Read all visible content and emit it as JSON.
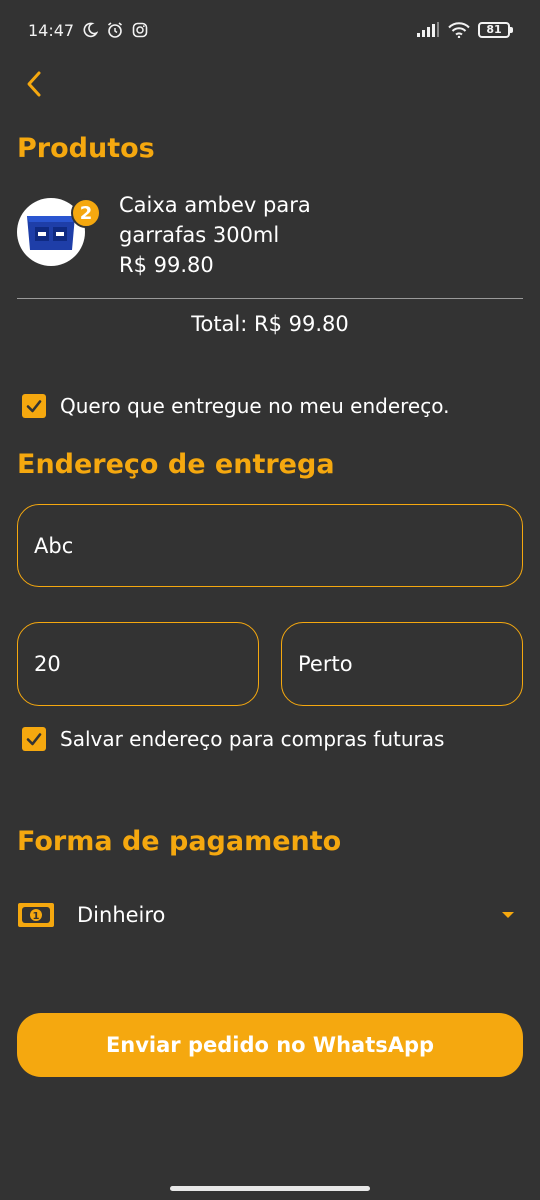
{
  "status_bar": {
    "time": "14:47",
    "battery": "81"
  },
  "products": {
    "title": "Produtos",
    "items": [
      {
        "name_line1": "Caixa ambev para",
        "name_line2": "garrafas 300ml",
        "price": "R$ 99.80",
        "quantity": "2"
      }
    ],
    "total": "Total: R$ 99.80"
  },
  "delivery": {
    "checkbox_label": "Quero que entregue no meu endereço.",
    "checked": true,
    "title": "Endereço de entrega",
    "street_value": "Abc",
    "number_value": "20",
    "complement_value": "Perto",
    "save_label": "Salvar endereço para compras futuras",
    "save_checked": true
  },
  "payment": {
    "title": "Forma de pagamento",
    "selected": "Dinheiro"
  },
  "actions": {
    "send_label": "Enviar pedido no WhatsApp"
  },
  "colors": {
    "accent": "#f5a80f",
    "background": "#333333",
    "text": "#ffffff"
  }
}
